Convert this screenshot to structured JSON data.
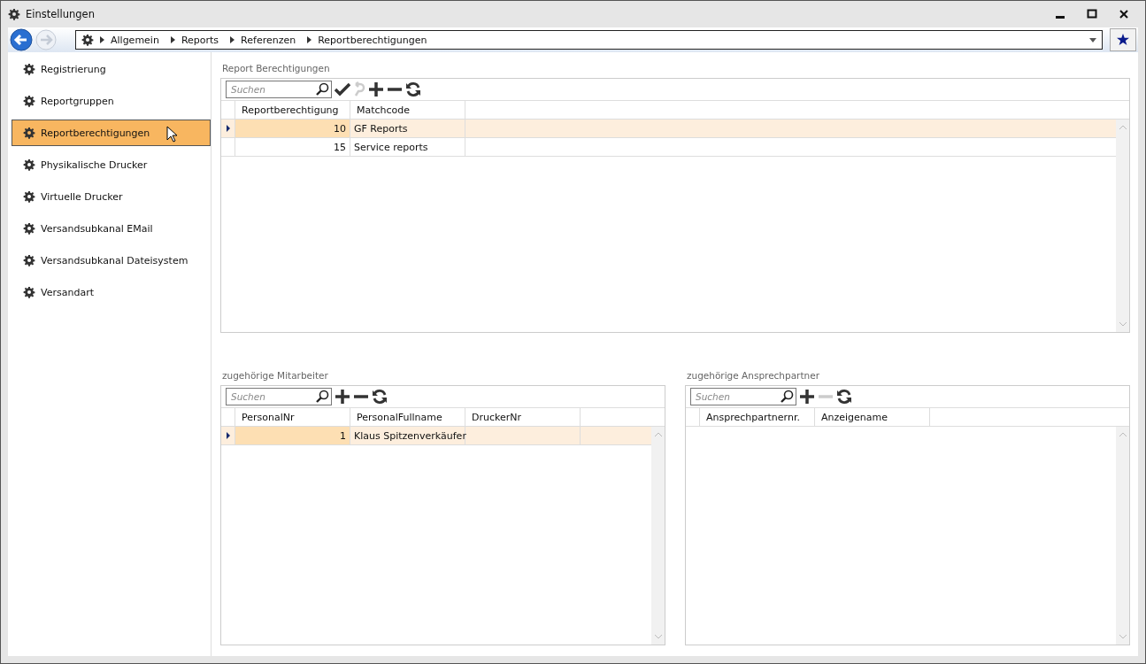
{
  "window": {
    "title": "Einstellungen"
  },
  "breadcrumb": [
    "Allgemein",
    "Reports",
    "Referenzen",
    "Reportberechtigungen"
  ],
  "sidebar": {
    "items": [
      {
        "label": "Registrierung",
        "selected": false
      },
      {
        "label": "Reportgruppen",
        "selected": false
      },
      {
        "label": "Reportberechtigungen",
        "selected": true
      },
      {
        "label": "Physikalische Drucker",
        "selected": false
      },
      {
        "label": "Virtuelle Drucker",
        "selected": false
      },
      {
        "label": "Versandsubkanal EMail",
        "selected": false
      },
      {
        "label": "Versandsubkanal Dateisystem",
        "selected": false
      },
      {
        "label": "Versandart",
        "selected": false
      }
    ]
  },
  "grids": [
    {
      "title": "Report Berechtigungen",
      "search": {
        "placeholder": "Suchen"
      },
      "tools": [
        {
          "kind": "save",
          "disabled": false
        },
        {
          "kind": "undo",
          "disabled": true
        },
        {
          "kind": "add",
          "disabled": false
        },
        {
          "kind": "remove",
          "disabled": false
        },
        {
          "kind": "refresh",
          "disabled": false
        }
      ],
      "columns": [
        "Reportberechtigung",
        "Matchcode"
      ],
      "rows": [
        {
          "selected": true,
          "cells": [
            "10",
            "GF Reports"
          ]
        },
        {
          "selected": false,
          "cells": [
            "15",
            "Service reports"
          ]
        }
      ]
    },
    {
      "title": "zugehörige Mitarbeiter",
      "search": {
        "placeholder": "Suchen"
      },
      "tools": [
        {
          "kind": "add",
          "disabled": false
        },
        {
          "kind": "remove",
          "disabled": false
        },
        {
          "kind": "refresh",
          "disabled": false
        }
      ],
      "columns": [
        "PersonalNr",
        "PersonalFullname",
        "DruckerNr"
      ],
      "rows": [
        {
          "selected": true,
          "cells": [
            "1",
            "Klaus Spitzenverkäufer",
            ""
          ]
        }
      ]
    },
    {
      "title": "zugehörige Ansprechpartner",
      "search": {
        "placeholder": "Suchen"
      },
      "tools": [
        {
          "kind": "add",
          "disabled": false
        },
        {
          "kind": "remove",
          "disabled": true
        },
        {
          "kind": "refresh",
          "disabled": false
        }
      ],
      "columns": [
        "Ansprechpartnernr.",
        "Anzeigename"
      ]
    }
  ]
}
